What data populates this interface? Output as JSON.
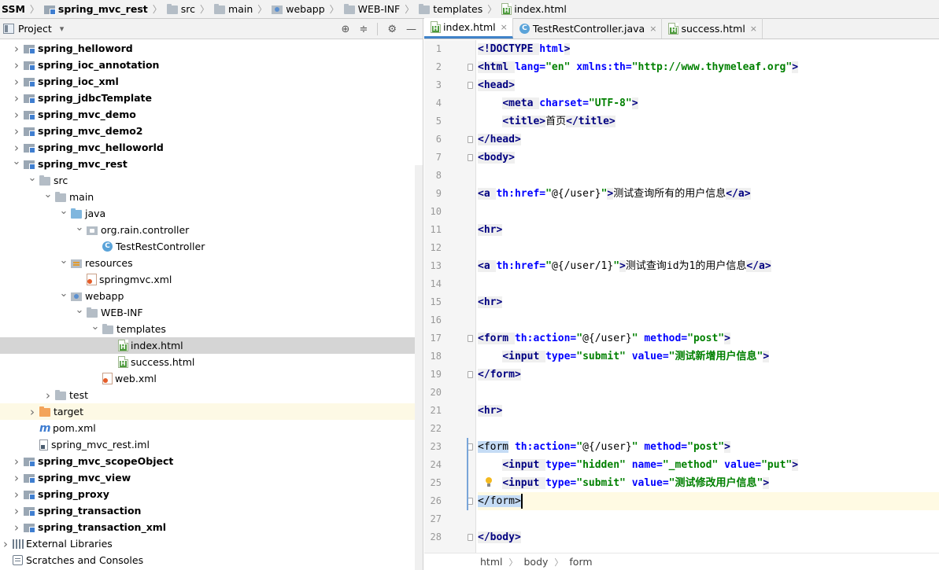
{
  "breadcrumb": [
    {
      "label": "SSM",
      "icon": "none",
      "bold": true
    },
    {
      "label": "spring_mvc_rest",
      "icon": "module-folder-icon",
      "bold": true
    },
    {
      "label": "src",
      "icon": "folder-icon",
      "bold": false
    },
    {
      "label": "main",
      "icon": "folder-icon",
      "bold": false
    },
    {
      "label": "webapp",
      "icon": "web-folder-icon",
      "bold": false
    },
    {
      "label": "WEB-INF",
      "icon": "folder-icon",
      "bold": false
    },
    {
      "label": "templates",
      "icon": "folder-icon",
      "bold": false
    },
    {
      "label": "index.html",
      "icon": "html-file-icon",
      "bold": false
    }
  ],
  "project_panel": {
    "title": "Project",
    "dropdown_glyph": "▾",
    "icons": [
      "target-icon",
      "collapse-all-icon",
      "gear-icon",
      "minimize-icon"
    ],
    "icon_glyphs": [
      "⊕",
      "≑",
      "⚙",
      "—"
    ],
    "tree": [
      {
        "label": "spring_helloword",
        "depth": 1,
        "arrow": "right",
        "icon": "module",
        "bold": true
      },
      {
        "label": "spring_ioc_annotation",
        "depth": 1,
        "arrow": "right",
        "icon": "module",
        "bold": true
      },
      {
        "label": "spring_ioc_xml",
        "depth": 1,
        "arrow": "right",
        "icon": "module",
        "bold": true
      },
      {
        "label": "spring_jdbcTemplate",
        "depth": 1,
        "arrow": "right",
        "icon": "module",
        "bold": true
      },
      {
        "label": "spring_mvc_demo",
        "depth": 1,
        "arrow": "right",
        "icon": "module",
        "bold": true
      },
      {
        "label": "spring_mvc_demo2",
        "depth": 1,
        "arrow": "right",
        "icon": "module",
        "bold": true
      },
      {
        "label": "spring_mvc_helloworld",
        "depth": 1,
        "arrow": "right",
        "icon": "module",
        "bold": true
      },
      {
        "label": "spring_mvc_rest",
        "depth": 1,
        "arrow": "down",
        "icon": "module",
        "bold": true
      },
      {
        "label": "src",
        "depth": 2,
        "arrow": "down",
        "icon": "folder",
        "bold": false
      },
      {
        "label": "main",
        "depth": 3,
        "arrow": "down",
        "icon": "folder",
        "bold": false
      },
      {
        "label": "java",
        "depth": 4,
        "arrow": "down",
        "icon": "folder-blue",
        "bold": false
      },
      {
        "label": "org.rain.controller",
        "depth": 5,
        "arrow": "down",
        "icon": "package",
        "bold": false
      },
      {
        "label": "TestRestController",
        "depth": 6,
        "arrow": "none",
        "icon": "class",
        "bold": false
      },
      {
        "label": "resources",
        "depth": 4,
        "arrow": "down",
        "icon": "resources",
        "bold": false
      },
      {
        "label": "springmvc.xml",
        "depth": 5,
        "arrow": "none",
        "icon": "xml",
        "bold": false
      },
      {
        "label": "webapp",
        "depth": 4,
        "arrow": "down",
        "icon": "web",
        "bold": false
      },
      {
        "label": "WEB-INF",
        "depth": 5,
        "arrow": "down",
        "icon": "folder",
        "bold": false
      },
      {
        "label": "templates",
        "depth": 6,
        "arrow": "down",
        "icon": "folder",
        "bold": false
      },
      {
        "label": "index.html",
        "depth": 7,
        "arrow": "none",
        "icon": "html",
        "bold": false,
        "selected": true
      },
      {
        "label": "success.html",
        "depth": 7,
        "arrow": "none",
        "icon": "html",
        "bold": false
      },
      {
        "label": "web.xml",
        "depth": 6,
        "arrow": "none",
        "icon": "xml",
        "bold": false
      },
      {
        "label": "test",
        "depth": 3,
        "arrow": "right",
        "icon": "folder",
        "bold": false
      },
      {
        "label": "target",
        "depth": 2,
        "arrow": "right",
        "icon": "folder-orange",
        "bold": false,
        "excluded": true
      },
      {
        "label": "pom.xml",
        "depth": 2,
        "arrow": "none",
        "icon": "maven",
        "bold": false
      },
      {
        "label": "spring_mvc_rest.iml",
        "depth": 2,
        "arrow": "none",
        "icon": "iml",
        "bold": false
      },
      {
        "label": "spring_mvc_scopeObject",
        "depth": 1,
        "arrow": "right",
        "icon": "module",
        "bold": true
      },
      {
        "label": "spring_mvc_view",
        "depth": 1,
        "arrow": "right",
        "icon": "module",
        "bold": true
      },
      {
        "label": "spring_proxy",
        "depth": 1,
        "arrow": "right",
        "icon": "module",
        "bold": true
      },
      {
        "label": "spring_transaction",
        "depth": 1,
        "arrow": "right",
        "icon": "module",
        "bold": true
      },
      {
        "label": "spring_transaction_xml",
        "depth": 1,
        "arrow": "right",
        "icon": "module",
        "bold": true
      },
      {
        "label": "External Libraries",
        "depth": 0,
        "arrow": "right",
        "icon": "libraries",
        "bold": false
      },
      {
        "label": "Scratches and Consoles",
        "depth": 0,
        "arrow": "none",
        "icon": "scratches",
        "bold": false
      }
    ]
  },
  "tabs": [
    {
      "label": "index.html",
      "icon": "html",
      "active": true
    },
    {
      "label": "TestRestController.java",
      "icon": "class",
      "active": false
    },
    {
      "label": "success.html",
      "icon": "html",
      "active": false
    }
  ],
  "tab_close_glyph": "×",
  "editor": {
    "current_line": 26,
    "lines": [
      [
        [
          "tag",
          "<!DOCTYPE "
        ],
        [
          "attr",
          "html"
        ],
        [
          "tag",
          ">"
        ]
      ],
      [
        [
          "tag",
          "<html "
        ],
        [
          "attr",
          "lang="
        ],
        [
          "str",
          "\"en\" "
        ],
        [
          "attr",
          "xmlns:th="
        ],
        [
          "str",
          "\"http://www.thymeleaf.org\""
        ],
        [
          "tag",
          ">"
        ]
      ],
      [
        [
          "tag",
          "<head>"
        ]
      ],
      [
        [
          "txt",
          "    "
        ],
        [
          "tag",
          "<meta "
        ],
        [
          "attr",
          "charset="
        ],
        [
          "str",
          "\"UTF-8\""
        ],
        [
          "tag",
          ">"
        ]
      ],
      [
        [
          "txt",
          "    "
        ],
        [
          "tag",
          "<title>"
        ],
        [
          "txt",
          "首页"
        ],
        [
          "tag",
          "</title>"
        ]
      ],
      [
        [
          "tag",
          "</head>"
        ]
      ],
      [
        [
          "tag",
          "<body>"
        ]
      ],
      [],
      [
        [
          "tag",
          "<a "
        ],
        [
          "attr",
          "th:href="
        ],
        [
          "str",
          "\""
        ],
        [
          "txt",
          "@{/user}"
        ],
        [
          "str",
          "\""
        ],
        [
          "tag",
          ">"
        ],
        [
          "txt",
          "测试查询所有的用户信息"
        ],
        [
          "tag",
          "</a>"
        ]
      ],
      [],
      [
        [
          "tag",
          "<hr>"
        ]
      ],
      [],
      [
        [
          "tag",
          "<a "
        ],
        [
          "attr",
          "th:href="
        ],
        [
          "str",
          "\""
        ],
        [
          "txt",
          "@{/user/1}"
        ],
        [
          "str",
          "\""
        ],
        [
          "tag",
          ">"
        ],
        [
          "txt",
          "测试查询id为1的用户信息"
        ],
        [
          "tag",
          "</a>"
        ]
      ],
      [],
      [
        [
          "tag",
          "<hr>"
        ]
      ],
      [],
      [
        [
          "tag",
          "<form "
        ],
        [
          "attr",
          "th:action="
        ],
        [
          "str",
          "\""
        ],
        [
          "txt",
          "@{/user}"
        ],
        [
          "str",
          "\" "
        ],
        [
          "attr",
          "method="
        ],
        [
          "str",
          "\"post\""
        ],
        [
          "tag",
          ">"
        ]
      ],
      [
        [
          "txt",
          "    "
        ],
        [
          "tag",
          "<input "
        ],
        [
          "attr",
          "type="
        ],
        [
          "str",
          "\"submit\" "
        ],
        [
          "attr",
          "value="
        ],
        [
          "str",
          "\"测试新增用户信息\""
        ],
        [
          "tag",
          ">"
        ]
      ],
      [
        [
          "tag",
          "</form>"
        ]
      ],
      [],
      [
        [
          "tag",
          "<hr>"
        ]
      ],
      [],
      [
        [
          "hl",
          "<form"
        ],
        [
          "attr",
          " th:action="
        ],
        [
          "str",
          "\""
        ],
        [
          "txt",
          "@{/user}"
        ],
        [
          "str",
          "\" "
        ],
        [
          "attr",
          "method="
        ],
        [
          "str",
          "\"post\""
        ],
        [
          "tag",
          ">"
        ]
      ],
      [
        [
          "txt",
          "    "
        ],
        [
          "tag",
          "<input "
        ],
        [
          "attr",
          "type="
        ],
        [
          "str",
          "\"hidden\" "
        ],
        [
          "attr",
          "name="
        ],
        [
          "str",
          "\"_method\" "
        ],
        [
          "attr",
          "value="
        ],
        [
          "str",
          "\"put\""
        ],
        [
          "tag",
          ">"
        ]
      ],
      [
        [
          "txt",
          "    "
        ],
        [
          "tag",
          "<input "
        ],
        [
          "attr",
          "type="
        ],
        [
          "str",
          "\"submit\" "
        ],
        [
          "attr",
          "value="
        ],
        [
          "str",
          "\"测试修改用户信息\""
        ],
        [
          "tag",
          ">"
        ]
      ],
      [
        [
          "hl",
          "</form>"
        ]
      ],
      [],
      [
        [
          "tag",
          "</body>"
        ]
      ]
    ]
  },
  "editor_breadcrumb": [
    "html",
    "body",
    "form"
  ],
  "colors": {
    "tag": "#000080",
    "attr": "#0000ff",
    "string": "#008000",
    "selection": "#d5d5d5",
    "accent": "#4083c9",
    "current_line": "#fffae3"
  }
}
